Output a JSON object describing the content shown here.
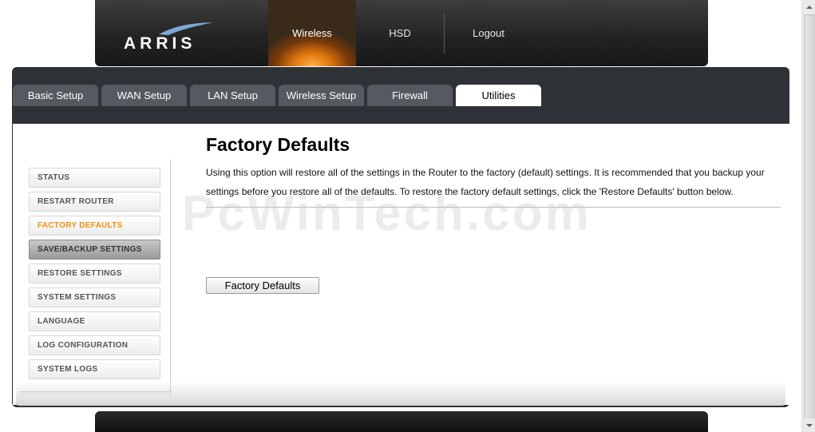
{
  "brand": {
    "logo_text": "ARRIS",
    "accent_color": "#f0900f"
  },
  "top_nav": [
    {
      "label": "Wireless",
      "active": true
    },
    {
      "label": "HSD",
      "active": false
    },
    {
      "label": "Logout",
      "active": false
    }
  ],
  "tabs": [
    {
      "label": "Basic Setup",
      "active": false
    },
    {
      "label": "WAN Setup",
      "active": false
    },
    {
      "label": "LAN Setup",
      "active": false
    },
    {
      "label": "Wireless Setup",
      "active": false
    },
    {
      "label": "Firewall",
      "active": false
    },
    {
      "label": "Utilities",
      "active": true
    }
  ],
  "sidebar": {
    "items": [
      {
        "label": "STATUS"
      },
      {
        "label": "RESTART ROUTER"
      },
      {
        "label": "FACTORY DEFAULTS",
        "active": true
      },
      {
        "label": "SAVE/BACKUP SETTINGS",
        "hover": true
      },
      {
        "label": "RESTORE SETTINGS"
      },
      {
        "label": "SYSTEM SETTINGS"
      },
      {
        "label": "LANGUAGE"
      },
      {
        "label": "LOG CONFIGURATION"
      },
      {
        "label": "SYSTEM LOGS"
      }
    ]
  },
  "main": {
    "title": "Factory Defaults",
    "description": "Using this option will restore all of the settings in the Router to the factory (default) settings. It is recommended that you backup your settings before you restore all of the defaults. To restore the factory default settings, click the 'Restore Defaults' button below.",
    "button_label": "Factory Defaults"
  },
  "watermark": "PcWinTech.com",
  "icons": {
    "logo": "arris-swoosh-icon",
    "scroll_up": "scroll-up-arrow-icon",
    "scroll_down": "scroll-down-arrow-icon"
  }
}
